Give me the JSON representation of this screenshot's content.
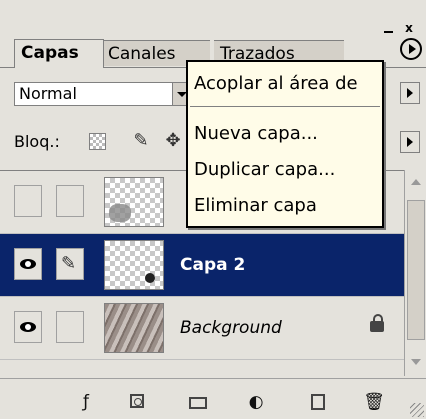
{
  "window": {
    "minimize_glyph": "",
    "close_glyph": "x"
  },
  "tabs": [
    {
      "label": "Capas",
      "active": true
    },
    {
      "label": "Canales",
      "active": false
    },
    {
      "label": "Trazados",
      "active": false
    }
  ],
  "blend_mode": {
    "value": "Normal"
  },
  "lock": {
    "label": "Bloq.:"
  },
  "layers": [
    {
      "name": "",
      "visible": false,
      "selected": false,
      "thumb": "transparent-with-shape"
    },
    {
      "name": "Capa 2",
      "visible": true,
      "selected": true,
      "thumb": "transparent-with-dot"
    },
    {
      "name": "Background",
      "visible": true,
      "selected": false,
      "thumb": "photo",
      "locked": true
    }
  ],
  "context_menu": {
    "items": [
      "Acoplar al área de",
      "Nueva capa...",
      "Duplicar capa...",
      "Eliminar capa"
    ]
  },
  "icons": {
    "brush": "✎",
    "move": "✥",
    "fx": "ƒ",
    "adjust": "◐",
    "trash": "🗑"
  },
  "colors": {
    "selection": "#0a246a",
    "menu_bg": "#fffce8",
    "panel_bg": "#e4e2dc"
  }
}
